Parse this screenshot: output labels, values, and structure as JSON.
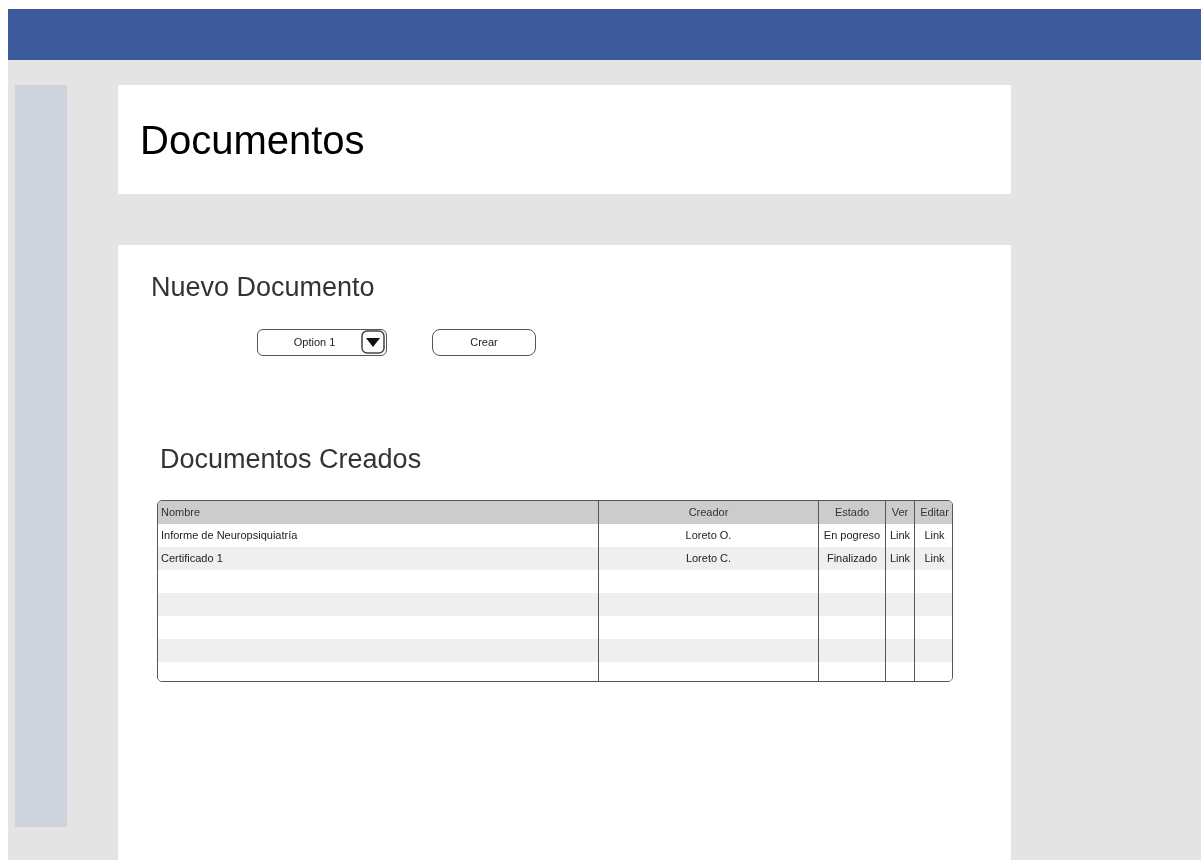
{
  "header": {
    "title": "Documentos"
  },
  "new_document": {
    "title": "Nuevo Documento",
    "dropdown": {
      "value": "Option 1"
    },
    "button": "Crear"
  },
  "documents": {
    "title": "Documentos Creados",
    "columns": [
      "Nombre",
      "Creador",
      "Estado",
      "Ver",
      "Editar"
    ],
    "rows": [
      {
        "nombre": "Informe de Neuropsiquiatría",
        "creador": "Loreto O.",
        "estado": "En pogreso",
        "ver": "Link",
        "editar": "Link"
      },
      {
        "nombre": "Certificado 1",
        "creador": "Loreto C.",
        "estado": "Finalizado",
        "ver": "Link",
        "editar": "Link"
      }
    ]
  }
}
